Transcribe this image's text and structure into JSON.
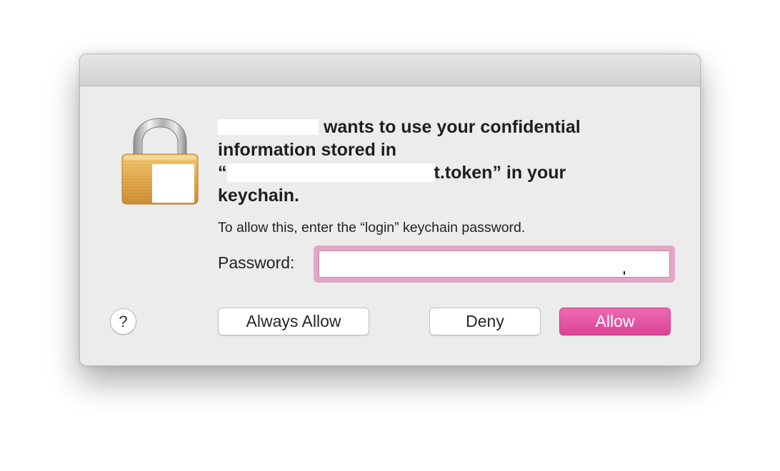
{
  "dialog": {
    "headline": {
      "line1_suffix": "wants to use your confidential",
      "line2": "information stored in",
      "line3_prefix": "“",
      "line3_suffix": "t.token” in your",
      "line4": "keychain."
    },
    "subtext": "To allow this, enter the “login” keychain password.",
    "password_label": "Password:",
    "password_value": "",
    "buttons": {
      "help": "?",
      "always_allow": "Always Allow",
      "deny": "Deny",
      "allow": "Allow"
    },
    "icons": {
      "lock": "lock-icon",
      "help": "help-icon"
    },
    "colors": {
      "accent": "#e0529f",
      "focus_ring": "#e3a7c3",
      "dialog_bg": "#ececec"
    }
  }
}
